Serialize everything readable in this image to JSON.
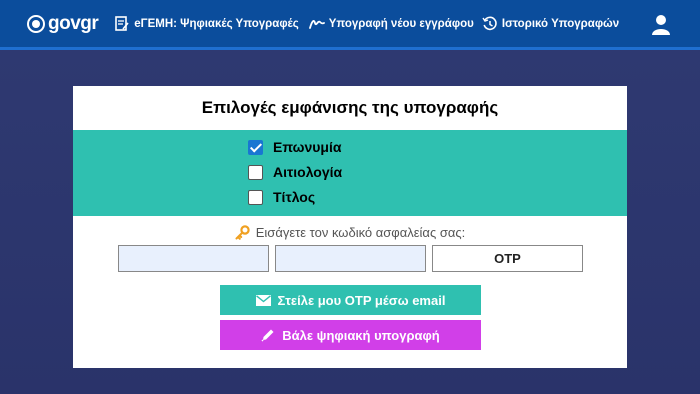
{
  "header": {
    "logo_text": "govgr",
    "nav": [
      {
        "label": "eΓΕΜΗ: Ψηφιακές Υπογραφές",
        "icon": "document-sign-icon"
      },
      {
        "label": "Υπογραφή νέου εγγράφου",
        "icon": "signature-icon"
      },
      {
        "label": "Ιστορικό Υπογραφών",
        "icon": "history-icon"
      }
    ],
    "user_icon": "user-icon"
  },
  "card": {
    "title": "Επιλογές εμφάνισης της υπογραφής",
    "options": [
      {
        "label": "Επωνυμία",
        "checked": true
      },
      {
        "label": "Αιτιολογία",
        "checked": false
      },
      {
        "label": "Τίτλος",
        "checked": false
      }
    ],
    "password_label": "Εισάγετε τον κωδικό ασφαλείας σας:",
    "password_fields": [
      {
        "value": "",
        "placeholder": ""
      },
      {
        "value": "",
        "placeholder": ""
      }
    ],
    "otp_label": "OTP",
    "email_button": "Στείλε μου OTP μέσω email",
    "sign_button": "Βάλε ψηφιακή υπογραφή"
  },
  "colors": {
    "header_bg": "#0b4d9c",
    "page_bg": "#2f3a72",
    "accent_teal": "#2fc0b0",
    "accent_magenta": "#d13fe8",
    "checkbox_blue": "#1976d2"
  }
}
